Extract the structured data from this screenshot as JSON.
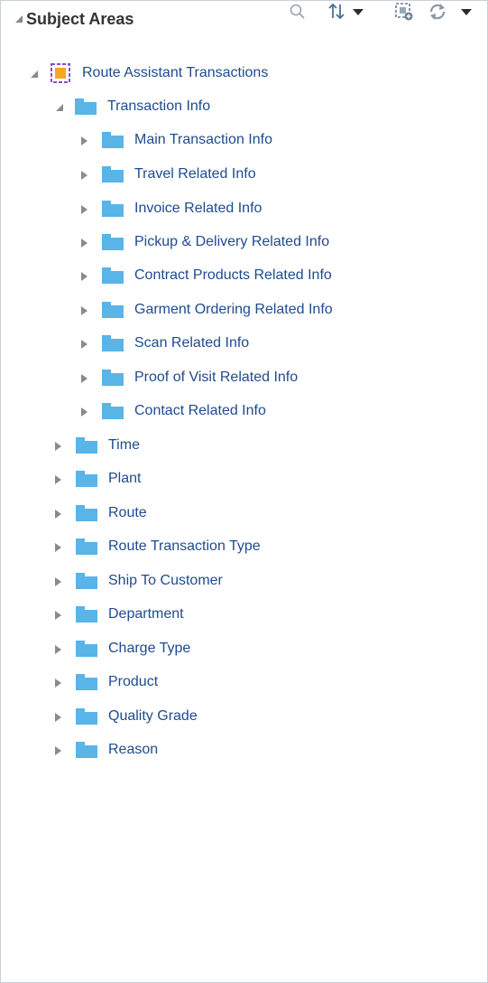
{
  "header": {
    "title": "Subject Areas",
    "search_icon": "search-icon",
    "sort_icon": "sort-icon",
    "add_icon": "add-subject-area-icon",
    "refresh_icon": "refresh-icon"
  },
  "tree": {
    "root": {
      "label": "Route Assistant Transactions",
      "icon": "subject-area-icon",
      "expanded": true
    },
    "transaction_info": {
      "label": "Transaction Info",
      "icon": "folder-icon",
      "expanded": true
    },
    "sub_items": [
      "Main Transaction Info",
      "Travel Related Info",
      "Invoice Related Info",
      "Pickup & Delivery Related Info",
      "Contract Products Related Info",
      "Garment Ordering Related Info",
      "Scan Related Info",
      "Proof of Visit Related Info",
      "Contact Related Info"
    ],
    "top_items": [
      "Time",
      "Plant",
      "Route",
      "Route Transaction Type",
      "Ship To Customer",
      "Department",
      "Charge Type",
      "Product",
      "Quality Grade",
      "Reason"
    ]
  },
  "colors": {
    "label": "#1f4b8e",
    "folder": "#59b4e8",
    "accent": "#f5a623"
  }
}
